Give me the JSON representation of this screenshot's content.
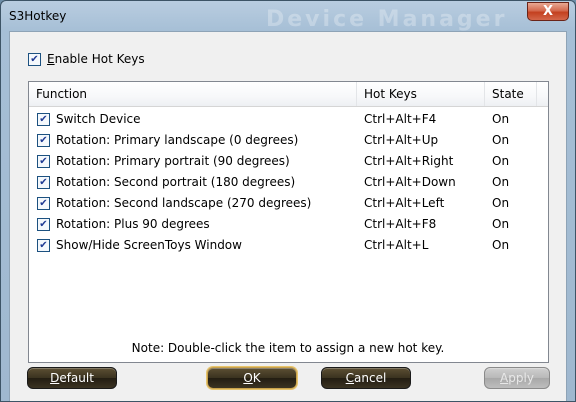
{
  "window": {
    "title": "S3Hotkey",
    "watermark": "Device Manager",
    "close_label": "X"
  },
  "enable": {
    "checked": true,
    "label_underlined": "E",
    "label_rest": "nable Hot Keys"
  },
  "list": {
    "columns": [
      "Function",
      "Hot Keys",
      "State"
    ],
    "rows": [
      {
        "function": "Switch Device",
        "hotkey": "Ctrl+Alt+F4",
        "state": "On"
      },
      {
        "function": "Rotation: Primary landscape (0 degrees)",
        "hotkey": "Ctrl+Alt+Up",
        "state": "On"
      },
      {
        "function": "Rotation: Primary portrait (90 degrees)",
        "hotkey": "Ctrl+Alt+Right",
        "state": "On"
      },
      {
        "function": "Rotation: Second portrait (180 degrees)",
        "hotkey": "Ctrl+Alt+Down",
        "state": "On"
      },
      {
        "function": "Rotation: Second landscape (270 degrees)",
        "hotkey": "Ctrl+Alt+Left",
        "state": "On"
      },
      {
        "function": "Rotation: Plus 90 degrees",
        "hotkey": "Ctrl+Alt+F8",
        "state": "On"
      },
      {
        "function": "Show/Hide ScreenToys Window",
        "hotkey": "Ctrl+Alt+L",
        "state": "On"
      }
    ]
  },
  "note": "Note: Double-click the item to assign a new hot key.",
  "buttons": {
    "default": {
      "underlined": "D",
      "rest": "efault"
    },
    "ok": {
      "underlined": "O",
      "rest": "K"
    },
    "cancel": {
      "underlined": "C",
      "rest": "ancel"
    },
    "apply": {
      "underlined": "A",
      "rest": "pply"
    }
  },
  "check_glyph": "✔"
}
